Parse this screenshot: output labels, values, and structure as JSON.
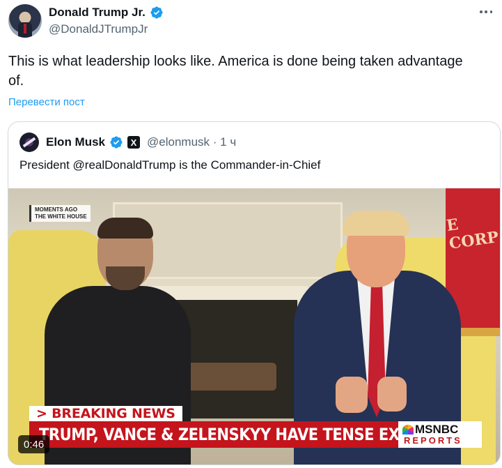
{
  "author": {
    "display_name": "Donald Trump Jr.",
    "handle": "@DonaldJTrumpJr",
    "verified": true
  },
  "tweet": {
    "text": "This is what leadership looks like. America is done being taken advantage of.",
    "translate_link": "Перевести пост"
  },
  "quoted": {
    "author_name": "Elon Musk",
    "x_badge": "X",
    "handle": "@elonmusk",
    "separator": " · ",
    "time": "1 ч",
    "text": "President @realDonaldTrump is the Commander-in-Chief",
    "video": {
      "overlay_top_line1": "MOMENTS AGO",
      "overlay_top_line2": "THE WHITE HOUSE",
      "breaking_label": "> BREAKING NEWS",
      "headline": "TRUMP, VANCE & ZELENSKYY HAVE TENSE EXCHANGE",
      "network": "MSNBC",
      "network_sub": "REPORTS",
      "flag_text": "CORP",
      "flag_text_top": "E",
      "duration": "0:46"
    }
  },
  "colors": {
    "link_blue": "#1d9bf0",
    "verified_blue": "#1d9bf0",
    "breaking_red": "#c4141c"
  },
  "icons": {
    "more": "more-dots-icon",
    "verified": "verified-badge-icon"
  }
}
